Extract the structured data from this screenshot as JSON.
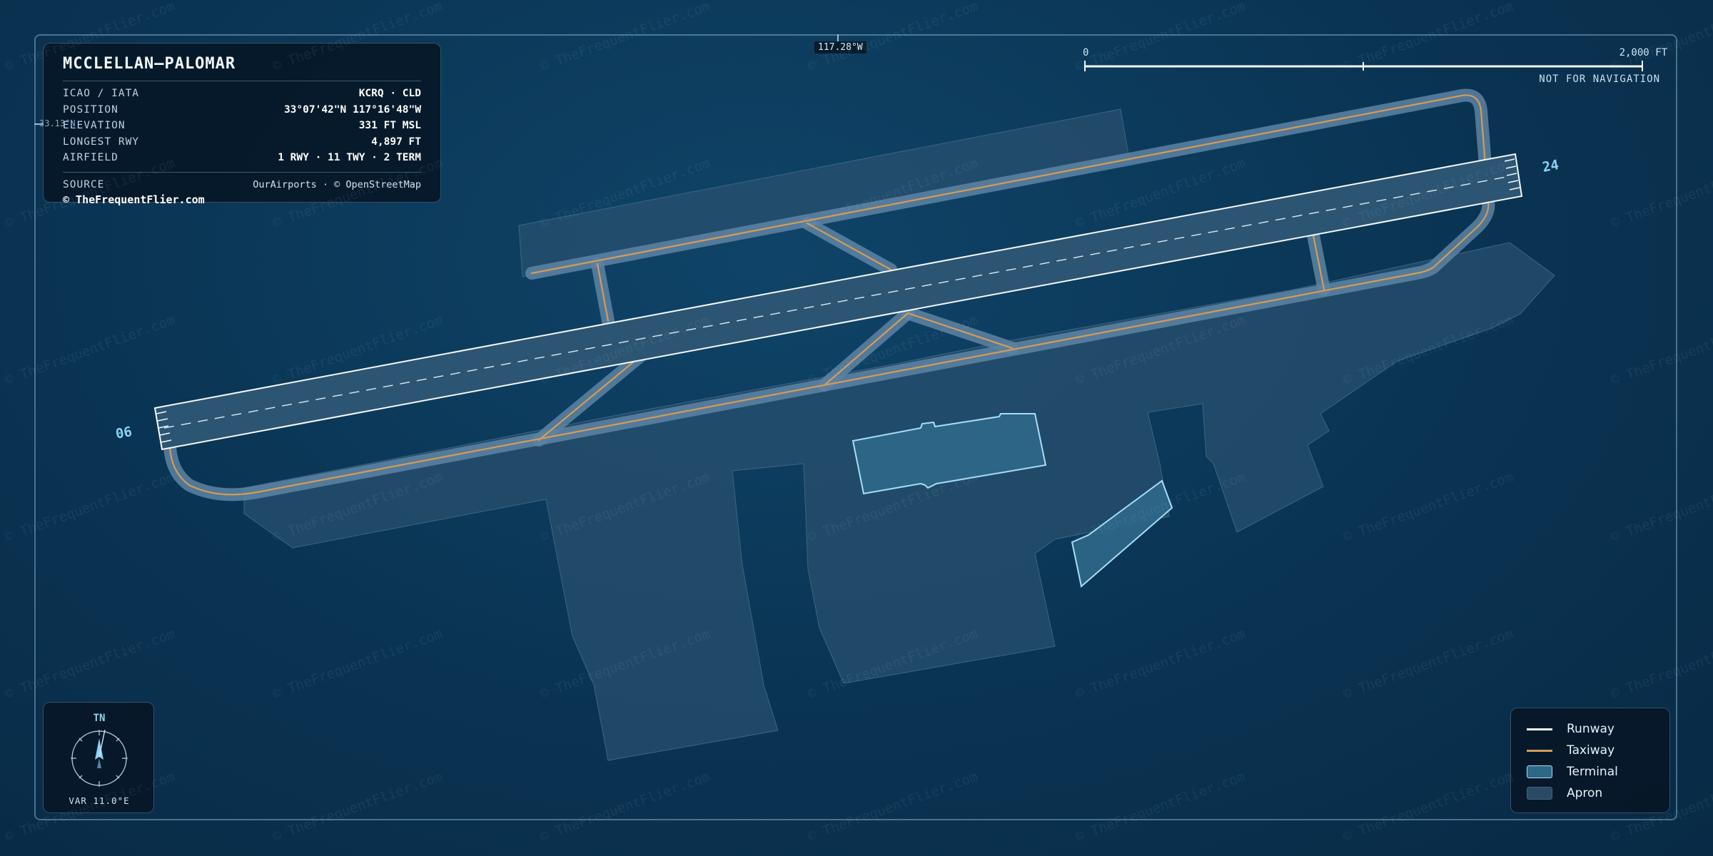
{
  "airport": {
    "name": "MCCLELLAN–PALOMAR"
  },
  "info": {
    "rows": [
      {
        "key": "ICAO / IATA",
        "value": "KCRQ · CLD"
      },
      {
        "key": "POSITION",
        "value": "33°07'42\"N 117°16'48\"W"
      },
      {
        "key": "ELEVATION",
        "value": "331 FT MSL"
      },
      {
        "key": "LONGEST RWY",
        "value": "4,897 FT"
      },
      {
        "key": "AIRFIELD",
        "value": "1 RWY · 11 TWY · 2 TERM"
      }
    ],
    "source_key": "SOURCE",
    "source_value": "OurAirports · © OpenStreetMap",
    "copyright": "© TheFrequentFlier.com"
  },
  "scale": {
    "start": "0",
    "end": "2,000 FT",
    "note": "NOT FOR NAVIGATION"
  },
  "graticule": {
    "longitude": "117.28°W",
    "latitude": "33.13°N"
  },
  "runway_ends": {
    "west": "06",
    "east": "24"
  },
  "compass": {
    "label": "TN",
    "variation": "VAR 11.0°E"
  },
  "legend": {
    "items": [
      "Runway",
      "Taxiway",
      "Terminal",
      "Apron"
    ]
  },
  "watermark": "© TheFrequentFlier.com",
  "colors": {
    "background": "#0a3352",
    "runway": "#f4f8fb",
    "taxiway": "#d59b55",
    "terminal": "#2d6888",
    "apron": "#2a4a63",
    "accent": "#8ad2f5"
  }
}
